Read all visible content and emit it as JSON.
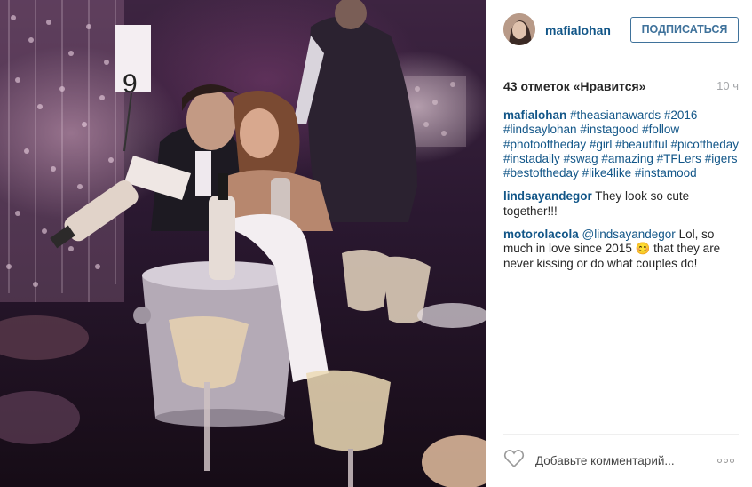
{
  "post": {
    "username": "mafialohan",
    "follow_label": "ПОДПИСАТЬСЯ",
    "likes": "43 отметок «Нравится»",
    "time": "10 ч",
    "caption": {
      "user": "mafialohan",
      "tags": [
        "#theasianawards",
        "#2016",
        "#lindsaylohan",
        "#instagood",
        "#follow",
        "#photooftheday",
        "#girl",
        "#beautiful",
        "#picoftheday",
        "#instadaily",
        "#swag",
        "#amazing",
        "#TFLers",
        "#igers",
        "#bestoftheday",
        "#like4like",
        "#instamood"
      ]
    },
    "comments": [
      {
        "user": "lindsayandegor",
        "text": "They look so cute together!!!"
      },
      {
        "user": "motorolacola",
        "mention": "@lindsayandegor",
        "text": "Lol, so much in love since 2015 😊 that they are never kissing or do what couples do!"
      }
    ],
    "comment_placeholder": "Добавьте комментарий...",
    "photo": {
      "table_number": "9"
    }
  },
  "icons": {
    "like": "heart-outline-icon",
    "more": "more-options-icon",
    "avatar": "user-avatar"
  }
}
